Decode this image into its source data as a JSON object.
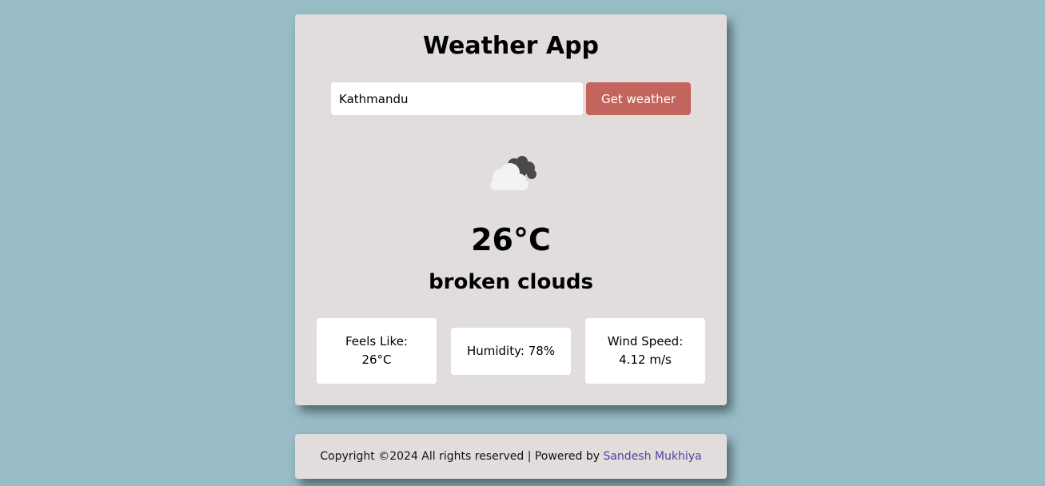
{
  "app": {
    "title": "Weather App"
  },
  "search": {
    "value": "Kathmandu",
    "button_label": "Get weather"
  },
  "weather": {
    "icon": "broken-clouds-icon",
    "temperature": "26°C",
    "description": "broken clouds"
  },
  "stats": {
    "feels_like_label": "Feels Like:",
    "feels_like_value": "26°C",
    "humidity_text": "Humidity: 78%",
    "wind_label": "Wind Speed:",
    "wind_value": "4.12 m/s"
  },
  "footer": {
    "text": "Copyright ©2024 All rights reserved | Powered by",
    "author": "Sandesh Mukhiya",
    "link_color": "#5b3aa0"
  },
  "colors": {
    "background": "#97bcc6",
    "card": "#e1dddc",
    "button": "#c4655d"
  }
}
